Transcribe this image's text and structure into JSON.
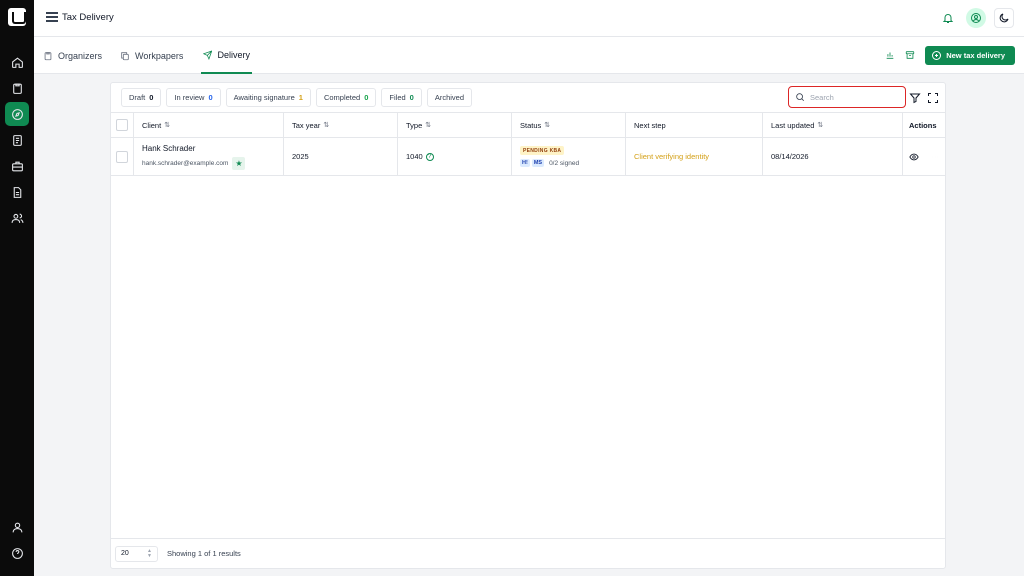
{
  "header": {
    "title": "Tax Delivery"
  },
  "rail": {
    "items": [
      "home-icon",
      "clipboard-icon",
      "compass-icon",
      "document-icon",
      "briefcase-icon",
      "file-text-icon",
      "users-icon"
    ],
    "bottom": [
      "user-icon",
      "help-icon"
    ],
    "active_index": 2
  },
  "subnav": {
    "tabs": [
      {
        "label": "Organizers",
        "icon": "clipboard-icon"
      },
      {
        "label": "Workpapers",
        "icon": "copy-icon"
      },
      {
        "label": "Delivery",
        "icon": "send-icon"
      }
    ],
    "active_tab": "Delivery",
    "new_button": "New tax delivery"
  },
  "filters": [
    {
      "label": "Draft",
      "count": "0",
      "color": "#111827"
    },
    {
      "label": "In review",
      "count": "0",
      "color": "#2563eb"
    },
    {
      "label": "Awaiting signature",
      "count": "1",
      "color": "#d4a017"
    },
    {
      "label": "Completed",
      "count": "0",
      "color": "#16a34a"
    },
    {
      "label": "Filed",
      "count": "0",
      "color": "#0f8a52"
    },
    {
      "label": "Archived",
      "count": "",
      "color": "#111827"
    }
  ],
  "search": {
    "placeholder": "Search",
    "value": ""
  },
  "table": {
    "columns": [
      "Client",
      "Tax year",
      "Type",
      "Status",
      "Next step",
      "Last updated",
      "Actions"
    ],
    "rows": [
      {
        "client_name": "Hank Schrader",
        "client_email": "hank.schrader@example.com",
        "tax_year": "2025",
        "type": "1040",
        "status_badge": "PENDING KBA",
        "signer_initials": [
          "H!",
          "MS"
        ],
        "signed": "0/2 signed",
        "next_step": "Client verifying identity",
        "last_updated": "08/14/2026"
      }
    ]
  },
  "footer": {
    "page_size": "20",
    "results_text": "Showing 1 of 1 results"
  },
  "colors": {
    "accent": "#0f8a52",
    "rail": "#0b0b0b",
    "next_step": "#d4a017",
    "search_border": "#dc2626"
  }
}
